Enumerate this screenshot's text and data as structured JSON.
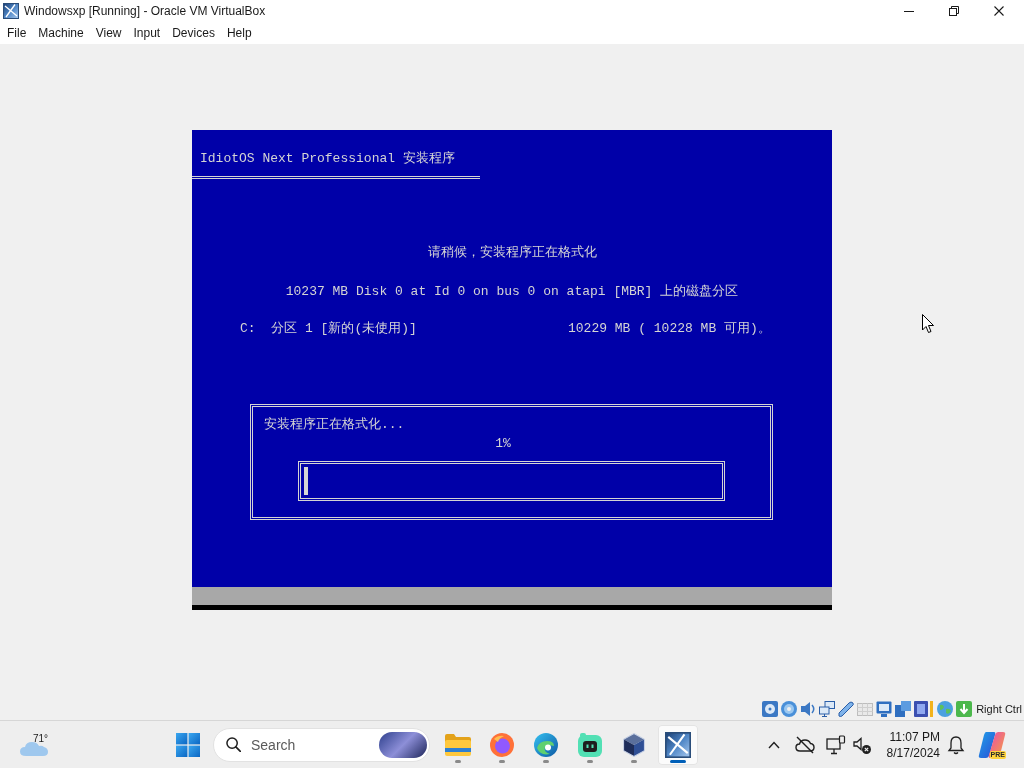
{
  "window": {
    "title": "Windowsxp [Running] - Oracle VM VirtualBox"
  },
  "menu": [
    "File",
    "Machine",
    "View",
    "Input",
    "Devices",
    "Help"
  ],
  "vm_screen": {
    "header": "IdiotOS Next Professional 安装程序",
    "message": "请稍候，安装程序正在格式化",
    "disk": "10237 MB Disk 0 at Id 0 on bus 0 on atapi [MBR] 上的磁盘分区",
    "partition": {
      "name": "C:  分区 1 [新的(未使用)]",
      "size": "10229 MB ( 10228 MB 可用)。"
    },
    "progress": {
      "caption": "安装程序正在格式化...",
      "percent": "1%",
      "level": 0.01
    }
  },
  "status_bar": {
    "host_key": "Right Ctrl"
  },
  "taskbar": {
    "weather": {
      "temperature": "71°"
    },
    "search": {
      "placeholder": "Search"
    },
    "apps": [
      {
        "kind": "folder",
        "selected": false
      },
      {
        "kind": "fox",
        "selected": false
      },
      {
        "kind": "wave",
        "selected": false
      },
      {
        "kind": "bot",
        "selected": false
      },
      {
        "kind": "cube",
        "selected": false
      },
      {
        "kind": "vm",
        "selected": true
      }
    ],
    "clock": {
      "time": "11:07 PM",
      "date": "8/17/2024"
    },
    "assistant": {
      "badge": "PRE"
    }
  }
}
